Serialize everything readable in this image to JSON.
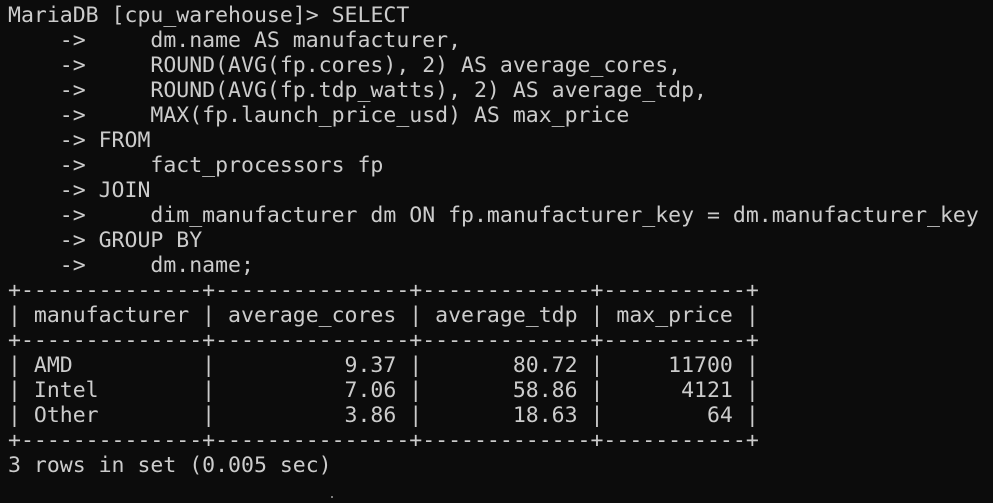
{
  "prompt": "MariaDB [cpu_warehouse]> ",
  "continuation": "    -> ",
  "query_lines": [
    "SELECT",
    "    dm.name AS manufacturer,",
    "    ROUND(AVG(fp.cores), 2) AS average_cores,",
    "    ROUND(AVG(fp.tdp_watts), 2) AS average_tdp,",
    "    MAX(fp.launch_price_usd) AS max_price",
    "FROM",
    "    fact_processors fp",
    "JOIN",
    "    dim_manufacturer dm ON fp.manufacturer_key = dm.manufacturer_key",
    "GROUP BY",
    "    dm.name;"
  ],
  "table": {
    "border": "+--------------+---------------+-------------+-----------+",
    "columns": [
      "manufacturer",
      "average_cores",
      "average_tdp",
      "max_price"
    ],
    "rows": [
      [
        "AMD",
        "9.37",
        "80.72",
        "11700"
      ],
      [
        "Intel",
        "7.06",
        "58.86",
        "4121"
      ],
      [
        "Other",
        "3.86",
        "18.63",
        "64"
      ]
    ]
  },
  "footer": "3 rows in set (0.005 sec)"
}
